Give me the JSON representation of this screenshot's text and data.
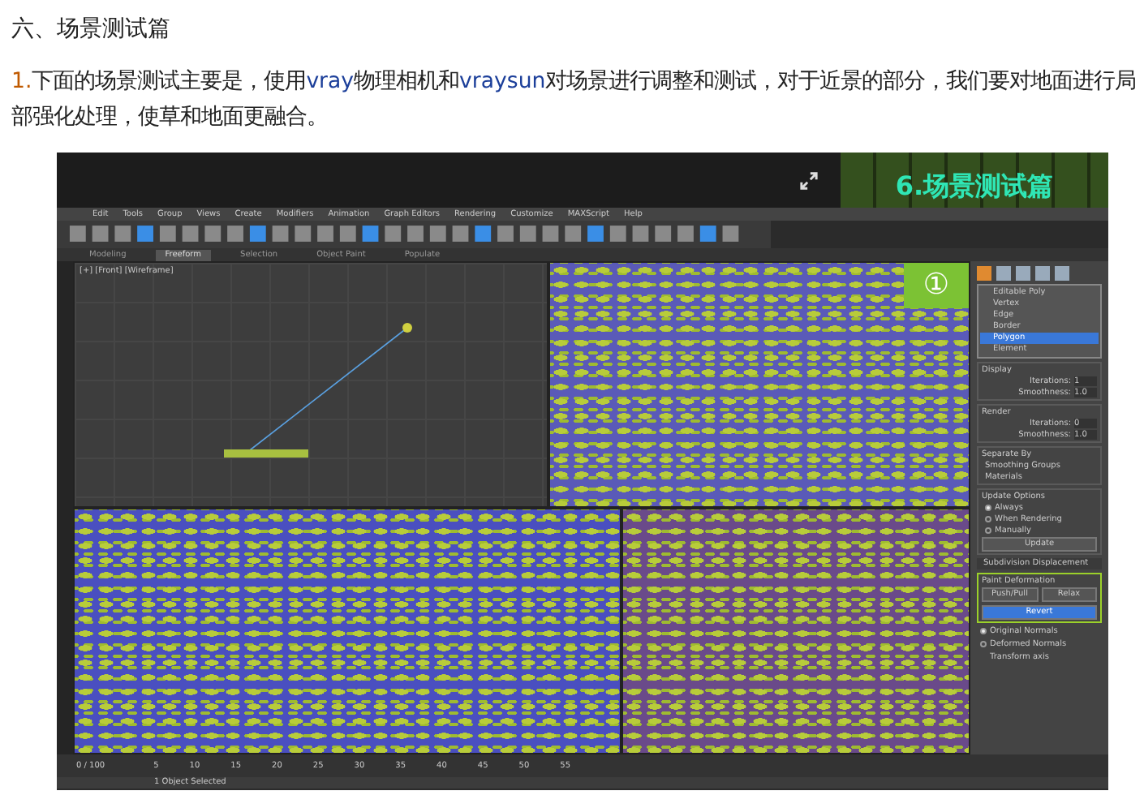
{
  "heading": "六、场景测试篇",
  "paragraph": [
    {
      "kind": "number",
      "text": "1."
    },
    {
      "kind": "plain",
      "text": "下面的场景测试主要是，使用"
    },
    {
      "kind": "term",
      "text": "vray"
    },
    {
      "kind": "plain",
      "text": "物理相机和"
    },
    {
      "kind": "term",
      "text": "vraysun"
    },
    {
      "kind": "plain",
      "text": "对场景进行调整和测试，对于近景的部分，我们要对地面进行局部强化处理，使草和地面更融合。"
    }
  ],
  "screenshot": {
    "banner_title": "6.场景测试篇",
    "menu": [
      "Edit",
      "Tools",
      "Group",
      "Views",
      "Create",
      "Modifiers",
      "Animation",
      "Graph Editors",
      "Rendering",
      "Customize",
      "MAXScript",
      "Help"
    ],
    "ribbon_tabs": [
      {
        "label": "Modeling",
        "selected": false
      },
      {
        "label": "Freeform",
        "selected": true
      },
      {
        "label": "Selection",
        "selected": false
      },
      {
        "label": "Object Paint",
        "selected": false
      },
      {
        "label": "Populate",
        "selected": false
      }
    ],
    "viewport_label": "[+] [Front] [Wireframe]",
    "step_badge": "①",
    "modifier_stack": [
      {
        "label": "Editable Poly",
        "selected": false
      },
      {
        "label": "Vertex",
        "selected": false
      },
      {
        "label": "Edge",
        "selected": false
      },
      {
        "label": "Border",
        "selected": false
      },
      {
        "label": "Polygon",
        "selected": true
      },
      {
        "label": "Element",
        "selected": false
      }
    ],
    "display": {
      "title": "Display",
      "iterations_label": "Iterations:",
      "iterations": "1",
      "smoothness_label": "Smoothness:",
      "smoothness": "1.0"
    },
    "render": {
      "title": "Render",
      "iterations_label": "Iterations:",
      "iterations": "0",
      "smoothness_label": "Smoothness:",
      "smoothness": "1.0"
    },
    "separate_by": {
      "title": "Separate By",
      "options": [
        "Smoothing Groups",
        "Materials"
      ]
    },
    "update_options": {
      "title": "Update Options",
      "options": [
        {
          "label": "Always",
          "selected": true
        },
        {
          "label": "When Rendering",
          "selected": false
        },
        {
          "label": "Manually",
          "selected": false
        }
      ],
      "button": "Update"
    },
    "subdivision_rollout": "Subdivision Displacement",
    "paint_deformation": {
      "title": "Paint Deformation",
      "buttons": [
        {
          "label": "Push/Pull",
          "selected": false
        },
        {
          "label": "Relax",
          "selected": false
        },
        {
          "label": "Revert",
          "selected": true
        }
      ]
    },
    "normals": [
      {
        "label": "Original Normals",
        "selected": true
      },
      {
        "label": "Deformed Normals",
        "selected": false
      }
    ],
    "transform_axis": "Transform axis",
    "frame_counter": "0 / 100",
    "timeline_ticks": [
      "5",
      "10",
      "15",
      "20",
      "25",
      "30",
      "35",
      "40",
      "45",
      "50",
      "55"
    ],
    "status": "1 Object Selected"
  }
}
